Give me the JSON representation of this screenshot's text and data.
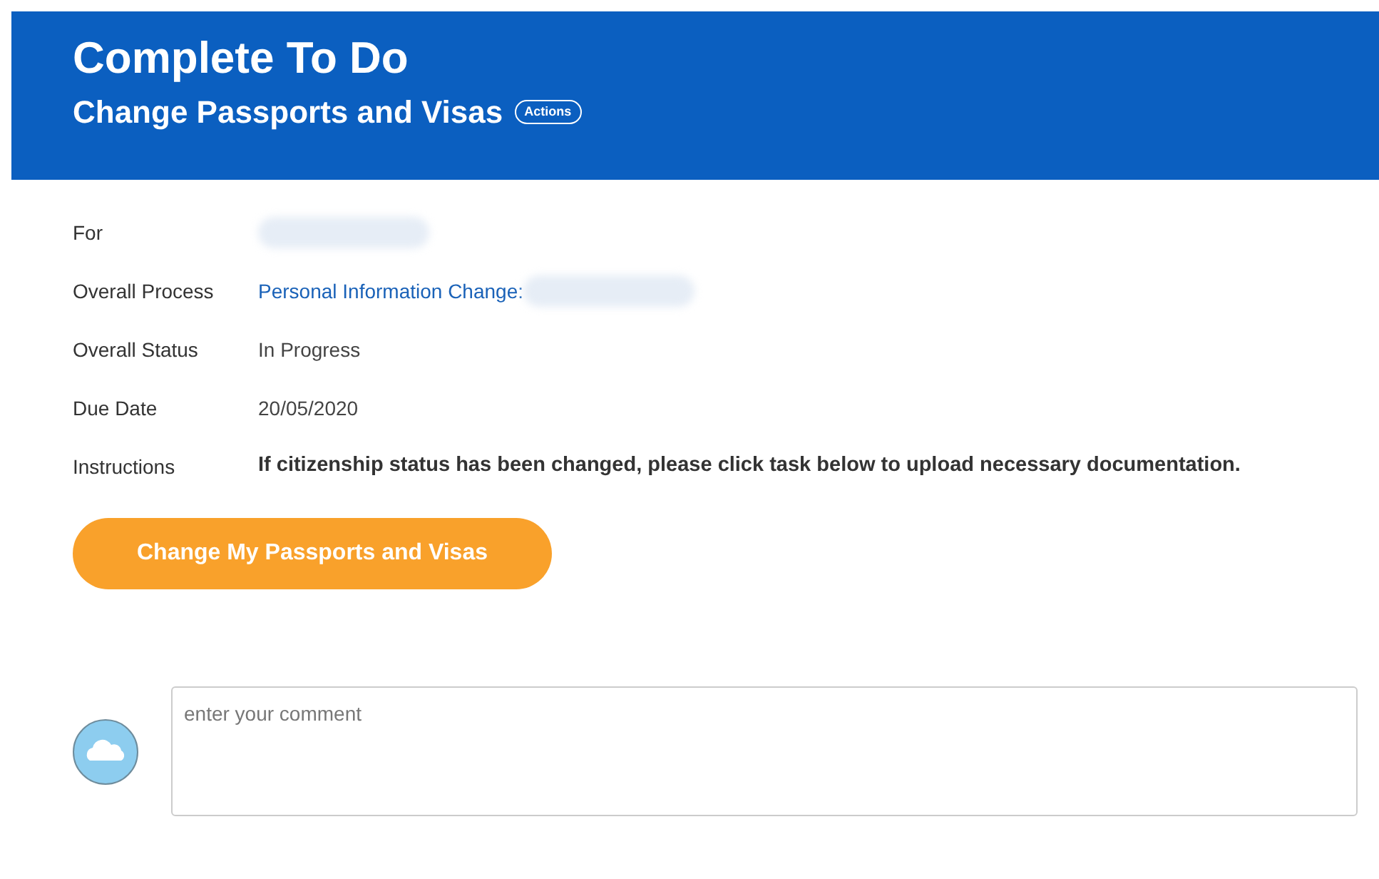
{
  "header": {
    "title": "Complete To Do",
    "subtitle": "Change Passports and Visas",
    "actions_label": "Actions"
  },
  "fields": [
    {
      "label": "For",
      "redacted": true
    },
    {
      "label": "Overall Process",
      "kind": "link",
      "value": "Personal Information Change:",
      "redacted": true
    },
    {
      "label": "Overall Status",
      "kind": "text",
      "value": "In Progress",
      "redacted": false
    },
    {
      "label": "Due Date",
      "kind": "text",
      "value": "20/05/2020",
      "redacted": false
    },
    {
      "label": "Instructions",
      "kind": "bold",
      "value": "If citizenship status has been changed, please click task below to upload necessary documentation.",
      "redacted": false
    }
  ],
  "task_button": "Change My Passports and Visas",
  "comment": {
    "placeholder": "enter your comment"
  }
}
